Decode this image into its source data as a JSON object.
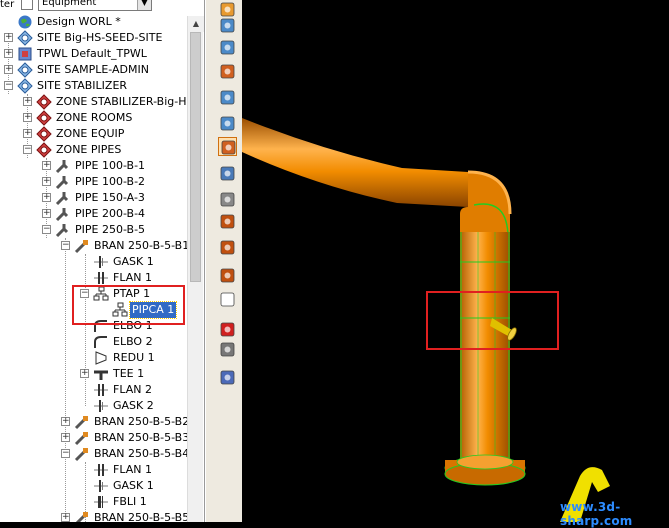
{
  "filter": {
    "label": "ter",
    "selected": "Equipment"
  },
  "tree": [
    {
      "label": "Design WORL *",
      "icon": "world-icon",
      "expander": "",
      "selected": false
    },
    {
      "label": "SITE Big-HS-SEED-SITE",
      "icon": "site-icon",
      "expander": "+",
      "selected": false
    },
    {
      "label": "TPWL Default_TPWL",
      "icon": "tpwl-icon",
      "expander": "+",
      "selected": false
    },
    {
      "label": "SITE SAMPLE-ADMIN",
      "icon": "site-icon",
      "expander": "+",
      "selected": false
    },
    {
      "label": "SITE STABILIZER",
      "icon": "site-icon",
      "expander": "−",
      "selected": false
    },
    {
      "label": "ZONE STABILIZER-Big-H",
      "icon": "zone-icon",
      "expander": "+",
      "selected": false
    },
    {
      "label": "ZONE ROOMS",
      "icon": "zone-icon",
      "expander": "+",
      "selected": false
    },
    {
      "label": "ZONE EQUIP",
      "icon": "zone-icon",
      "expander": "+",
      "selected": false
    },
    {
      "label": "ZONE PIPES",
      "icon": "zone-icon",
      "expander": "−",
      "selected": false
    },
    {
      "label": "PIPE 100-B-1",
      "icon": "pipe-icon",
      "expander": "+",
      "selected": false
    },
    {
      "label": "PIPE 100-B-2",
      "icon": "pipe-icon",
      "expander": "+",
      "selected": false
    },
    {
      "label": "PIPE 150-A-3",
      "icon": "pipe-icon",
      "expander": "+",
      "selected": false
    },
    {
      "label": "PIPE 200-B-4",
      "icon": "pipe-icon",
      "expander": "+",
      "selected": false
    },
    {
      "label": "PIPE 250-B-5",
      "icon": "pipe-icon",
      "expander": "−",
      "selected": false
    },
    {
      "label": "BRAN 250-B-5-B1",
      "icon": "branch-icon",
      "expander": "−",
      "selected": false
    },
    {
      "label": "GASK 1",
      "icon": "gasket-icon",
      "expander": "",
      "selected": false
    },
    {
      "label": "FLAN 1",
      "icon": "flange-icon",
      "expander": "",
      "selected": false
    },
    {
      "label": "PTAP 1",
      "icon": "ptap-icon",
      "expander": "−",
      "selected": false
    },
    {
      "label": "PIPCA 1",
      "icon": "pipca-icon",
      "expander": "",
      "selected": true
    },
    {
      "label": "ELBO 1",
      "icon": "elbow-icon",
      "expander": "",
      "selected": false
    },
    {
      "label": "ELBO 2",
      "icon": "elbow-icon",
      "expander": "",
      "selected": false
    },
    {
      "label": "REDU 1",
      "icon": "reducer-icon",
      "expander": "",
      "selected": false
    },
    {
      "label": "TEE 1",
      "icon": "tee-icon",
      "expander": "+",
      "selected": false
    },
    {
      "label": "FLAN 2",
      "icon": "flange-icon",
      "expander": "",
      "selected": false
    },
    {
      "label": "GASK 2",
      "icon": "gasket-icon",
      "expander": "",
      "selected": false
    },
    {
      "label": "BRAN 250-B-5-B2",
      "icon": "branch-icon",
      "expander": "+",
      "selected": false
    },
    {
      "label": "BRAN 250-B-5-B3",
      "icon": "branch-icon",
      "expander": "+",
      "selected": false
    },
    {
      "label": "BRAN 250-B-5-B4",
      "icon": "branch-icon",
      "expander": "−",
      "selected": false
    },
    {
      "label": "FLAN 1",
      "icon": "flange-icon",
      "expander": "",
      "selected": false
    },
    {
      "label": "GASK 1",
      "icon": "gasket-icon",
      "expander": "",
      "selected": false
    },
    {
      "label": "FBLI 1",
      "icon": "fbli-icon",
      "expander": "",
      "selected": false
    },
    {
      "label": "BRAN 250-B-5-B5",
      "icon": "branch-icon",
      "expander": "+",
      "selected": false
    }
  ],
  "toolbar": [
    "walk-icon",
    "zoom-window-icon",
    "zoom-fit-icon",
    "orbit-icon",
    "zoom-in-out-icon",
    "zoom-icon",
    "rotate-view-icon",
    "pan-icon",
    "fly-icon",
    "clip-box-icon",
    "clip-ce-icon",
    "clip-plane-icon",
    "refresh-icon",
    "axes-icon",
    "cluster-icon",
    "window-icon"
  ],
  "viewport": {
    "watermark": "www.3d-sharp.com",
    "pipe_color": "#f28c00",
    "highlight_color": "#e02020"
  }
}
